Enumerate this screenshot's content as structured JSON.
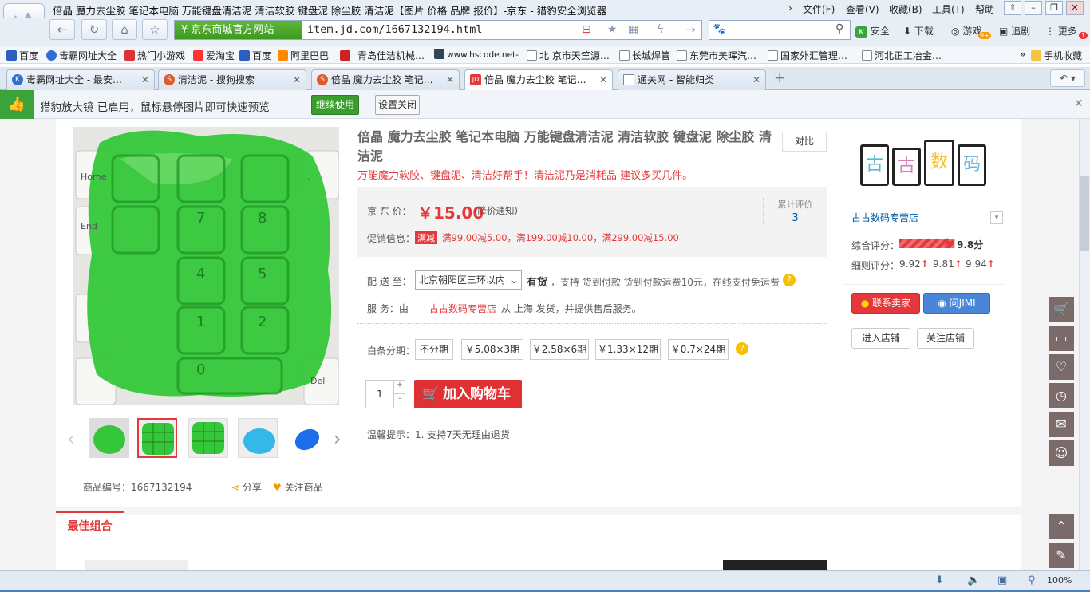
{
  "browser": {
    "window_title": "倍晶 魔力去尘胶 笔记本电脑 万能键盘清洁泥 清洁软胶 键盘泥 除尘胶 清洁泥【图片 价格 品牌 报价】-京东 - 猎豹安全浏览器",
    "menus": [
      "文件(F)",
      "查看(V)",
      "收藏(B)",
      "工具(T)",
      "帮助"
    ],
    "address_badge": "京东商城官方网站",
    "url": "item.jd.com/1667132194.html",
    "toolbar_items": [
      "安全",
      "下载",
      "游戏",
      "追剧",
      "更多"
    ],
    "games_badge": "9+",
    "more_badge": "1",
    "bookmarks": [
      "百度",
      "毒霸网址大全",
      "热门小游戏",
      "爱淘宝",
      "百度",
      "阿里巴巴",
      "_青岛佳洁机械…",
      "www.hscode.net-",
      "北 京市天竺源…",
      "长城焊管",
      "东莞市美晖汽…",
      "国家外汇管理…",
      "河北正工冶金…"
    ],
    "bookmark_folder": "手机收藏",
    "tabs": [
      {
        "label": "毒霸网址大全 - 最安…",
        "icon": "K",
        "color": "#2d6fd6"
      },
      {
        "label": "清洁泥 - 搜狗搜索",
        "icon": "S",
        "color": "#e25a2b"
      },
      {
        "label": "倍晶 魔力去尘胶 笔记…",
        "icon": "S",
        "color": "#e25a2b"
      },
      {
        "label": "倍晶 魔力去尘胶 笔记…",
        "icon": "JD",
        "color": "#e4393c"
      },
      {
        "label": "通关网 - 智能归类",
        "icon": "",
        "color": "#ffffff"
      }
    ],
    "zoom": "100%"
  },
  "notify": {
    "text": "猎豹放大镜 已启用，鼠标悬停图片即可快速预览",
    "continue_label": "继续使用",
    "close_label": "设置关闭"
  },
  "product": {
    "title": "倍晶 魔力去尘胶 笔记本电脑 万能键盘清洁泥 清洁软胶 键盘泥 除尘胶 清洁泥",
    "subtitle": "万能魔力软胶、键盘泥、清洁好帮手！清洁泥乃是消耗品 建议多买几件。",
    "compare_label": "对比",
    "price_label": "京 东 价：",
    "price": "￥15.00",
    "price_notice": "(降价通知)",
    "rating_label": "累计评价",
    "rating_count": "3",
    "promo_label": "促销信息：",
    "promo_tag": "满减",
    "promo_text": "满99.00减5.00，满199.00减10.00，满299.00减15.00",
    "ship_label": "配 送 至：",
    "ship_location": "北京朝阳区三环以内",
    "stock": "有货",
    "ship_desc": "，支持 货到付款   货到付款运费10元，在线支付免运费",
    "service_label": "服      务：由",
    "service_store": "古古数码专营店",
    "service_desc": "从 上海 发货，并提供售后服务。",
    "installment_label": "白条分期：",
    "installments": [
      "不分期",
      "￥5.08×3期",
      "￥2.58×6期",
      "￥1.33×12期",
      "￥0.7×24期"
    ],
    "quantity": "1",
    "add_to_cart": "加入购物车",
    "tip": "温馨提示：1. 支持7天无理由退货",
    "sku_label": "商品编号：1667132194",
    "share_label": "分享",
    "follow_label": "关注商品"
  },
  "store": {
    "logo_chars": [
      "古",
      "古",
      "数",
      "码"
    ],
    "name": "古古数码专营店",
    "overall_label": "综合评分：",
    "overall_score": "9.8分",
    "overall_level": 0.98,
    "detail_label": "细则评分：",
    "detail_scores": [
      "9.92",
      "9.81",
      "9.94"
    ],
    "contact_label": "联系卖家",
    "jimi_label": "问JIMI",
    "enter_label": "进入店铺",
    "follow_label": "关注店铺"
  },
  "combo": {
    "tab_label": "最佳组合"
  },
  "colors": {
    "jd_red": "#e4393c",
    "accent_green": "#3aa33a",
    "link_blue": "#005ea7"
  }
}
